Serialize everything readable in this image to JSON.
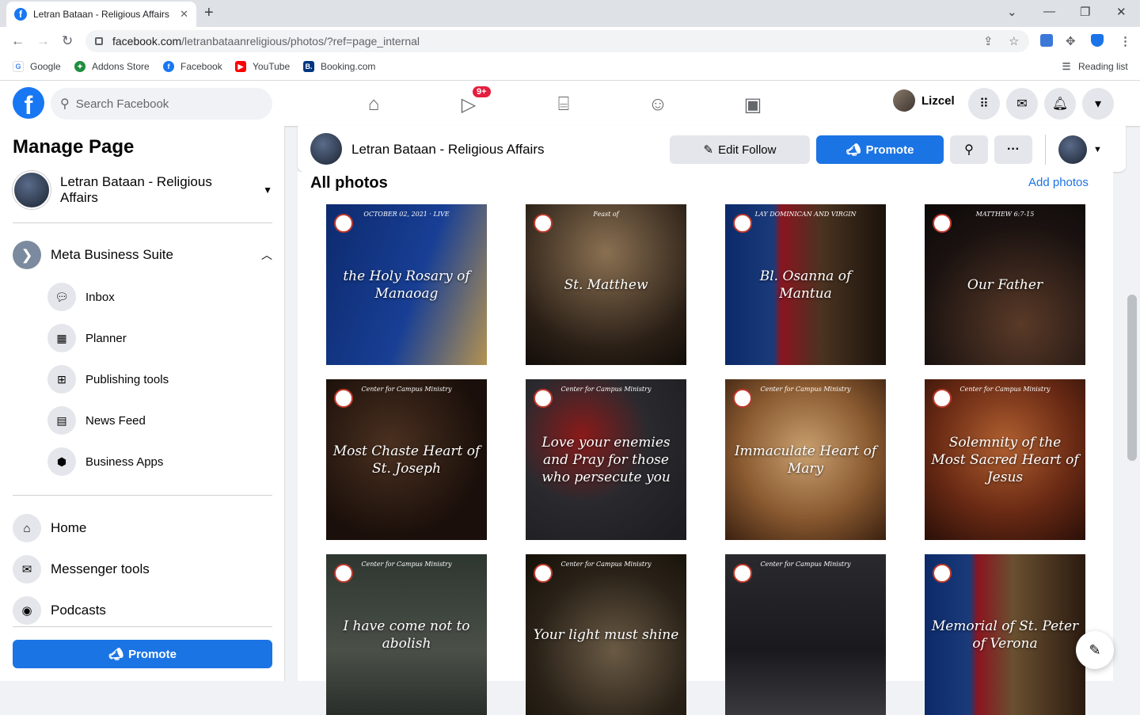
{
  "browser": {
    "tab_title": "Letran Bataan - Religious Affairs",
    "tab_close": "✕",
    "new_tab": "+",
    "url_host": "facebook.com",
    "url_path": "/letranbataanreligious/photos/?ref=page_internal",
    "bookmarks": [
      "Google",
      "Addons Store",
      "Facebook",
      "YouTube",
      "Booking.com"
    ],
    "reading_list": "Reading list"
  },
  "header": {
    "search_placeholder": "Search Facebook",
    "watch_badge": "9+",
    "profile_name": "Lizcel"
  },
  "sidebar": {
    "title": "Manage Page",
    "page_name": "Letran Bataan - Religious Affairs",
    "meta_suite": "Meta Business Suite",
    "suite_items": [
      "Inbox",
      "Planner",
      "Publishing tools",
      "News Feed",
      "Business Apps"
    ],
    "main_items": [
      "Home",
      "Messenger tools",
      "Podcasts"
    ],
    "promote": "Promote"
  },
  "pagebar": {
    "name": "Letran Bataan - Religious Affairs",
    "edit_follow": "Edit Follow",
    "promote": "Promote"
  },
  "photos": {
    "title": "All photos",
    "add": "Add photos",
    "items": [
      {
        "caption": "the Holy Rosary of Manaoag",
        "org": "OCTOBER 02, 2021 · LIVE",
        "bg": "linear-gradient(110deg,#0d2a6e 0%,#183f95 55%,#b39251 100%)"
      },
      {
        "caption": "St. Matthew",
        "org": "Feast of",
        "bg": "radial-gradient(circle at 50% 30%,#8a7052,#2a1f16 70%,#120d09)"
      },
      {
        "caption": "Bl. Osanna of Mantua",
        "org": "LAY DOMINICAN AND VIRGIN",
        "bg": "linear-gradient(90deg,#0c2a6a 0%,#1a3a7a 30%,#8a1520 35%,#4a3320 60%,#1a120c 100%)"
      },
      {
        "caption": "Our Father",
        "org": "MATTHEW 6:7-15",
        "bg": "radial-gradient(circle at 60% 75%,#5a3a28,#1a1210 65%,#0c0908)"
      },
      {
        "caption": "Most Chaste Heart of St. Joseph",
        "org": "Center for Campus Ministry",
        "bg": "radial-gradient(circle at 40% 40%,#4a3020,#1a0f0a 70%)"
      },
      {
        "caption": "Love your enemies and Pray for those who persecute you",
        "org": "Center for Campus Ministry",
        "bg": "radial-gradient(circle at 35% 35%,#8a1a1a,#2a2a2e 45%,#1c1c20)"
      },
      {
        "caption": "Immaculate Heart of Mary",
        "org": "Center for Campus Ministry",
        "bg": "radial-gradient(circle at 50% 45%,#c9a070,#8a5a30 55%,#3a2010)"
      },
      {
        "caption": "Solemnity of the Most Sacred Heart of Jesus",
        "org": "Center for Campus Ministry",
        "bg": "radial-gradient(circle at 50% 40%,#b06030,#6a2a14 55%,#2a0f08)"
      },
      {
        "caption": "I have come not to abolish",
        "org": "Center for Campus Ministry",
        "bg": "linear-gradient(180deg,#2e3630,#4a5048 60%,#2a2e2a)"
      },
      {
        "caption": "Your light must shine",
        "org": "Center for Campus Ministry",
        "bg": "radial-gradient(circle at 55% 60%,#6a5a45,#2a2218 60%,#141008)"
      },
      {
        "caption": "",
        "org": "Center for Campus Ministry",
        "bg": "linear-gradient(180deg,#2a2a2e,#1a1a1e 60%,#3a3a3e)"
      },
      {
        "caption": "Memorial of St. Peter of Verona",
        "org": "",
        "bg": "linear-gradient(90deg,#0c2a6a 0%,#1a3a7a 28%,#8a1520 33%,#6a5030 55%,#2a1a10 100%)"
      }
    ]
  }
}
